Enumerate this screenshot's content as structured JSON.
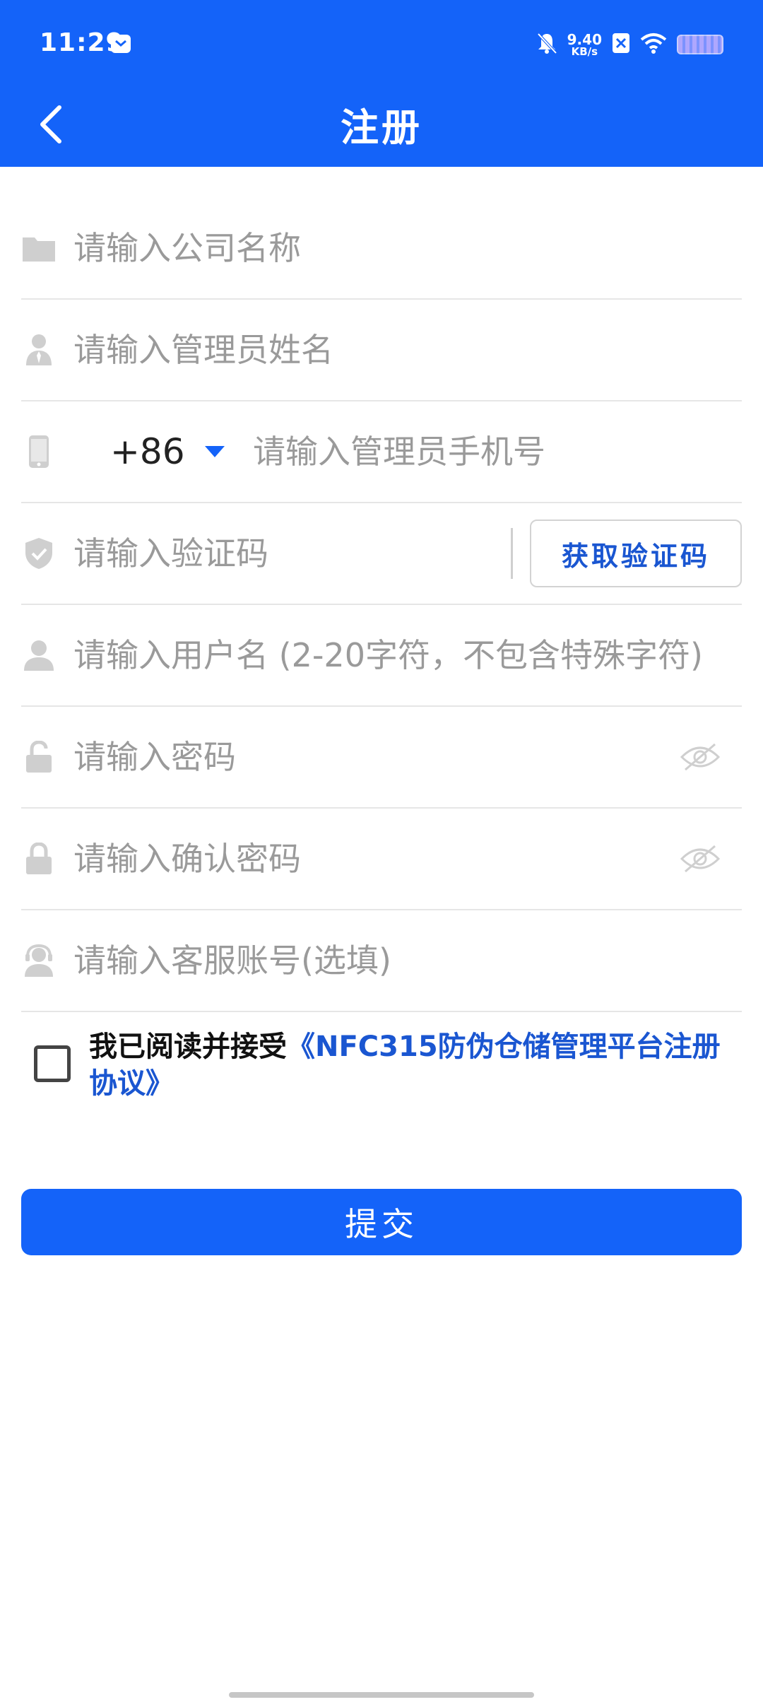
{
  "status_bar": {
    "time": "11:29",
    "net_speed_value": "9.40",
    "net_speed_unit": "KB/s"
  },
  "toolbar": {
    "title": "注册"
  },
  "form": {
    "company_placeholder": "请输入公司名称",
    "admin_name_placeholder": "请输入管理员姓名",
    "country_code": "+86",
    "phone_placeholder": "请输入管理员手机号",
    "code_placeholder": "请输入验证码",
    "get_code_label": "获取验证码",
    "username_placeholder": "请输入用户名 (2-20字符，不包含特殊字符)",
    "password_placeholder": "请输入密码",
    "confirm_password_placeholder": "请输入确认密码",
    "service_account_placeholder": "请输入客服账号(选填)"
  },
  "agreement": {
    "prefix": "我已阅读并接受",
    "link": "《NFC315防伪仓储管理平台注册协议》"
  },
  "submit_label": "提交",
  "colors": {
    "primary": "#1463f9",
    "link": "#1a56d1",
    "icon_gray": "#cfcfcf"
  }
}
